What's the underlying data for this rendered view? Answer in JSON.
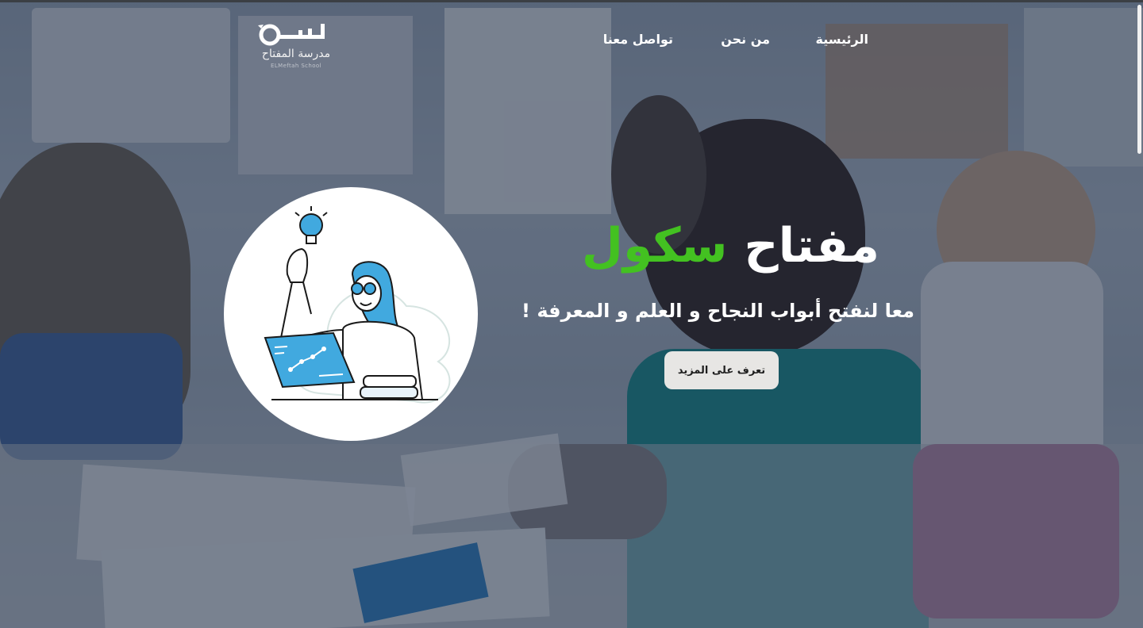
{
  "brand": {
    "logo_text": "مدرسة المفتاح",
    "logo_subtext": "ELMeftah School"
  },
  "nav": {
    "home": "الرئيسية",
    "about": "من نحن",
    "contact": "تواصل معنا"
  },
  "hero": {
    "title_main": "مفتاح",
    "title_accent": "سكول",
    "subtitle": "معا لنفتح أبواب النجاح و العلم و المعرفة !",
    "cta_label": "تعرف على المزيد"
  },
  "illustration": {
    "icon": "student-lightbulb-laptop-illustration"
  },
  "colors": {
    "accent": "#43c121",
    "illustration_blue": "#41a9df",
    "button_bg": "#e7e6e4",
    "overlay": "#1d2f4f"
  }
}
